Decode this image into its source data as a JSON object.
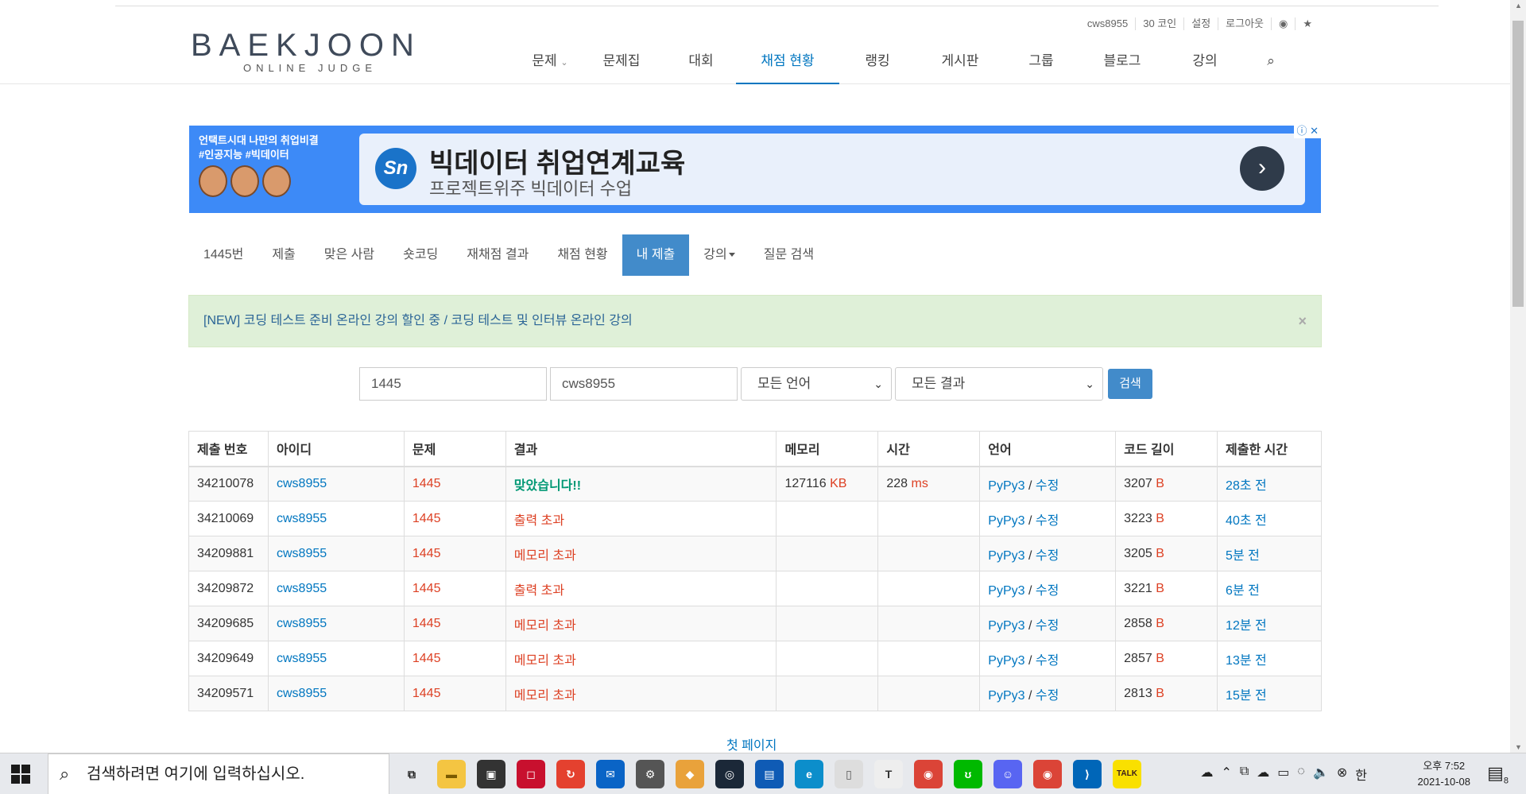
{
  "header": {
    "logo_main": "BAEKJOON",
    "logo_sub": "ONLINE JUDGE",
    "user_menu": [
      "cws8955",
      "30 코인",
      "설정",
      "로그아웃"
    ],
    "nav": [
      "문제",
      "문제집",
      "대회",
      "채점 현황",
      "랭킹",
      "게시판",
      "그룹",
      "블로그",
      "강의"
    ],
    "active_nav": "채점 현황"
  },
  "ad": {
    "left_line1": "언택트시대 나만의 취업비결",
    "left_line2": "#인공지능 #빅데이터",
    "logo_text": "Sn",
    "title": "빅데이터 취업연계교육",
    "subtitle": "프로젝트위주 빅데이터 수업",
    "arrow": "›",
    "info": "ⓘ ✕"
  },
  "problem_tabs": [
    "1445번",
    "제출",
    "맞은 사람",
    "숏코딩",
    "재채점 결과",
    "채점 현황",
    "내 제출",
    "강의",
    "질문 검색"
  ],
  "active_tab": "내 제출",
  "alert": {
    "text": "[NEW] 코딩 테스트 준비 온라인 강의 할인 중 / 코딩 테스트 및 인터뷰 온라인 강의",
    "close": "×"
  },
  "search": {
    "problem": "1445",
    "user": "cws8955",
    "language": "모든 언어",
    "result": "모든 결과",
    "button": "검색"
  },
  "table": {
    "headers": [
      "제출 번호",
      "아이디",
      "문제",
      "결과",
      "메모리",
      "시간",
      "언어",
      "코드 길이",
      "제출한 시간"
    ],
    "rows": [
      {
        "id": "34210078",
        "user": "cws8955",
        "problem": "1445",
        "result": "맞았습니다!!",
        "memory": "127116",
        "memory_unit": "KB",
        "time": "228",
        "time_unit": "ms",
        "lang": "PyPy3",
        "edit": "수정",
        "length": "3207",
        "length_unit": "B",
        "when": "28초 전"
      },
      {
        "id": "34210069",
        "user": "cws8955",
        "problem": "1445",
        "result": "출력 초과",
        "memory": "",
        "memory_unit": "",
        "time": "",
        "time_unit": "",
        "lang": "PyPy3",
        "edit": "수정",
        "length": "3223",
        "length_unit": "B",
        "when": "40초 전"
      },
      {
        "id": "34209881",
        "user": "cws8955",
        "problem": "1445",
        "result": "메모리 초과",
        "memory": "",
        "memory_unit": "",
        "time": "",
        "time_unit": "",
        "lang": "PyPy3",
        "edit": "수정",
        "length": "3205",
        "length_unit": "B",
        "when": "5분 전"
      },
      {
        "id": "34209872",
        "user": "cws8955",
        "problem": "1445",
        "result": "출력 초과",
        "memory": "",
        "memory_unit": "",
        "time": "",
        "time_unit": "",
        "lang": "PyPy3",
        "edit": "수정",
        "length": "3221",
        "length_unit": "B",
        "when": "6분 전"
      },
      {
        "id": "34209685",
        "user": "cws8955",
        "problem": "1445",
        "result": "메모리 초과",
        "memory": "",
        "memory_unit": "",
        "time": "",
        "time_unit": "",
        "lang": "PyPy3",
        "edit": "수정",
        "length": "2858",
        "length_unit": "B",
        "when": "12분 전"
      },
      {
        "id": "34209649",
        "user": "cws8955",
        "problem": "1445",
        "result": "메모리 초과",
        "memory": "",
        "memory_unit": "",
        "time": "",
        "time_unit": "",
        "lang": "PyPy3",
        "edit": "수정",
        "length": "2857",
        "length_unit": "B",
        "when": "13분 전"
      },
      {
        "id": "34209571",
        "user": "cws8955",
        "problem": "1445",
        "result": "메모리 초과",
        "memory": "",
        "memory_unit": "",
        "time": "",
        "time_unit": "",
        "lang": "PyPy3",
        "edit": "수정",
        "length": "2813",
        "length_unit": "B",
        "when": "15분 전"
      }
    ]
  },
  "pager": "첫 페이지",
  "taskbar": {
    "search_placeholder": "검색하려면 여기에 입력하십시오.",
    "apps": [
      {
        "name": "task-view-icon",
        "label": "⧉",
        "color": "#e7e9ed",
        "fg": "#222"
      },
      {
        "name": "file-explorer-icon",
        "label": "▬",
        "color": "#f4c542",
        "fg": "#7a5a00"
      },
      {
        "name": "store-icon",
        "label": "▣",
        "color": "#333",
        "fg": "#fff"
      },
      {
        "name": "app-red-icon",
        "label": "◻",
        "color": "#c8102e",
        "fg": "#fff"
      },
      {
        "name": "sync-icon",
        "label": "↻",
        "color": "#e4412f",
        "fg": "#fff"
      },
      {
        "name": "mail-icon",
        "label": "✉",
        "color": "#0a64c6",
        "fg": "#fff"
      },
      {
        "name": "settings-app-icon",
        "label": "⚙",
        "color": "#555",
        "fg": "#fff"
      },
      {
        "name": "sketch-icon",
        "label": "◆",
        "color": "#e9a23b",
        "fg": "#fff"
      },
      {
        "name": "steam-icon",
        "label": "◎",
        "color": "#1b2838",
        "fg": "#fff"
      },
      {
        "name": "reader-icon",
        "label": "▤",
        "color": "#0f5bb5",
        "fg": "#fff"
      },
      {
        "name": "edge-icon",
        "label": "e",
        "color": "#0c8ecb",
        "fg": "#fff"
      },
      {
        "name": "notepad-icon",
        "label": "▯",
        "color": "#ddd",
        "fg": "#555"
      },
      {
        "name": "typora-icon",
        "label": "T",
        "color": "#eee",
        "fg": "#333"
      },
      {
        "name": "chrome-icon",
        "label": "◉",
        "color": "#db4437",
        "fg": "#fff"
      },
      {
        "name": "line-icon",
        "label": "ʊ",
        "color": "#00b900",
        "fg": "#fff"
      },
      {
        "name": "discord-icon",
        "label": "☺",
        "color": "#5865f2",
        "fg": "#fff"
      },
      {
        "name": "chrome-2-icon",
        "label": "◉",
        "color": "#db4437",
        "fg": "#fff"
      },
      {
        "name": "vscode-icon",
        "label": "⟩",
        "color": "#0066b8",
        "fg": "#fff"
      },
      {
        "name": "kakaotalk-icon",
        "label": "TALK",
        "color": "#f9e000",
        "fg": "#3b1e1e"
      }
    ],
    "tray": [
      "☁",
      "⌃",
      "⧉",
      "☁",
      "▭",
      "◌",
      "🔈",
      "⊗",
      "한"
    ],
    "time_period": "오후 7:52",
    "date": "2021-10-08",
    "notification_count": "8"
  }
}
